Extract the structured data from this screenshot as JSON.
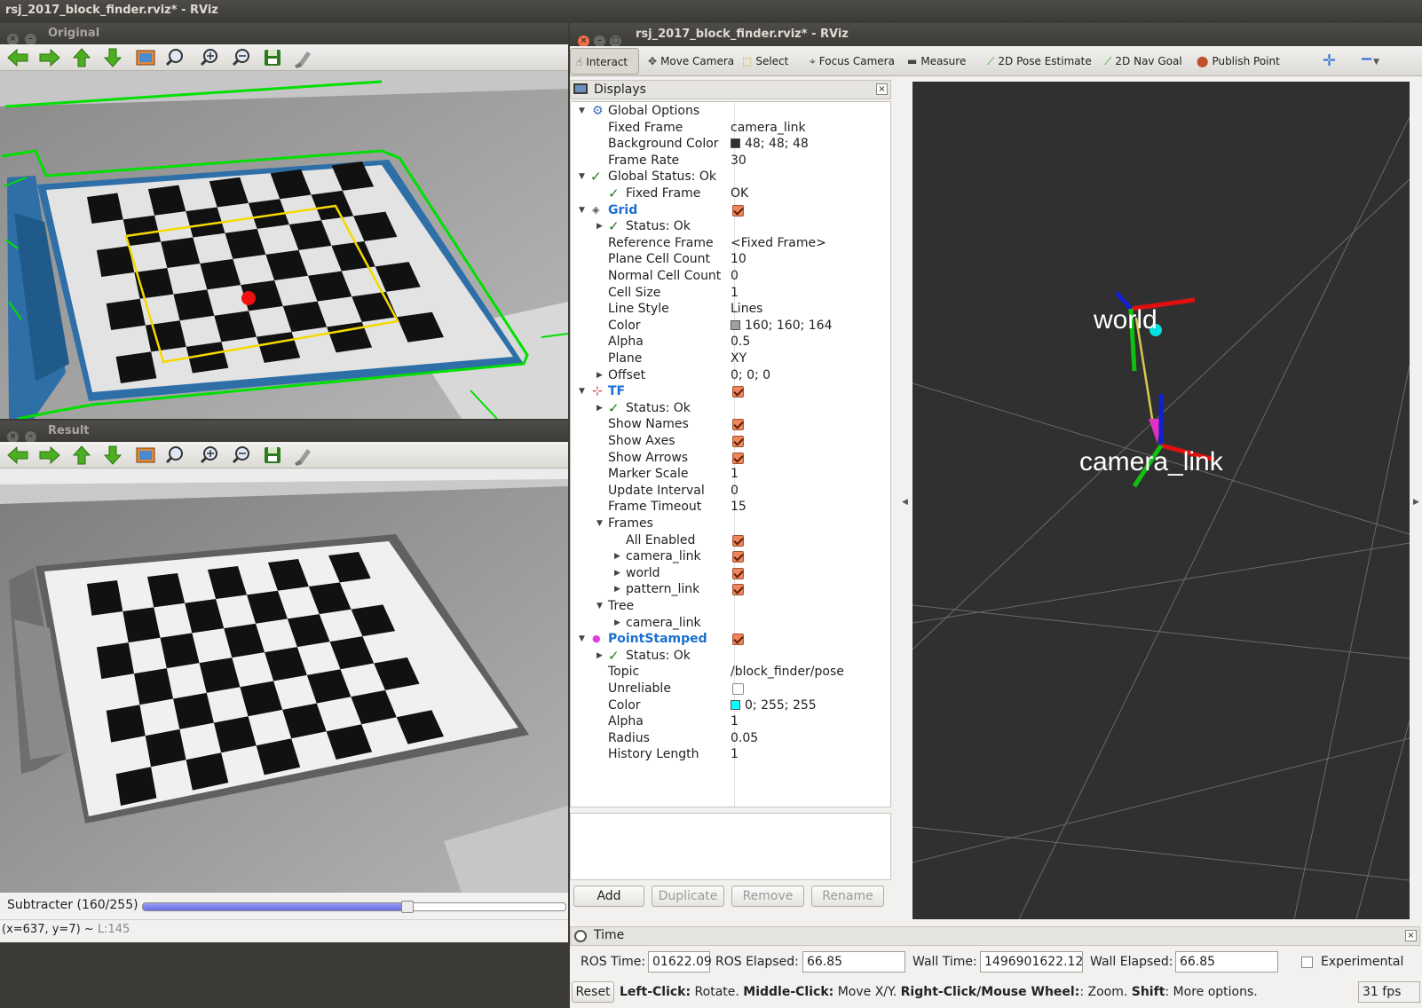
{
  "desktop_title": "rsj_2017_block_finder.rviz* - RViz",
  "original_window": {
    "title": "Original",
    "toolbar_icons": [
      "arrow-left-icon",
      "arrow-right-icon",
      "arrow-up-icon",
      "arrow-down-icon",
      "image-icon",
      "zoom-fit-icon",
      "zoom-in-icon",
      "zoom-out-icon",
      "save-icon",
      "brush-icon"
    ]
  },
  "result_window": {
    "title": "Result",
    "slider_label": "Subtracter (160/255)",
    "slider_value": 0.627,
    "status_coords": "(x=637, y=7) ~",
    "status_level": "L:145"
  },
  "rviz": {
    "title": "rsj_2017_block_finder.rviz* - RViz",
    "tools": [
      {
        "label": "Interact",
        "icon": "cursor-icon"
      },
      {
        "label": "Move Camera",
        "icon": "move-camera-icon"
      },
      {
        "label": "Select",
        "icon": "select-icon"
      },
      {
        "label": "Focus Camera",
        "icon": "focus-camera-icon"
      },
      {
        "label": "Measure",
        "icon": "measure-icon"
      },
      {
        "label": "2D Pose Estimate",
        "icon": "pose-estimate-icon"
      },
      {
        "label": "2D Nav Goal",
        "icon": "nav-goal-icon"
      },
      {
        "label": "Publish Point",
        "icon": "publish-point-icon"
      }
    ],
    "displays_title": "Displays",
    "tree": [
      {
        "label": "Global Options",
        "value": ""
      },
      {
        "label": "Fixed Frame",
        "value": "camera_link"
      },
      {
        "label": "Background Color",
        "value": "48; 48; 48",
        "swatch": "#303030"
      },
      {
        "label": "Frame Rate",
        "value": "30"
      },
      {
        "label": "Global Status: Ok",
        "value": ""
      },
      {
        "label": "Fixed Frame",
        "value": "OK"
      },
      {
        "label": "Grid",
        "value": ""
      },
      {
        "label": "Status: Ok",
        "value": ""
      },
      {
        "label": "Reference Frame",
        "value": "<Fixed Frame>"
      },
      {
        "label": "Plane Cell Count",
        "value": "10"
      },
      {
        "label": "Normal Cell Count",
        "value": "0"
      },
      {
        "label": "Cell Size",
        "value": "1"
      },
      {
        "label": "Line Style",
        "value": "Lines"
      },
      {
        "label": "Color",
        "value": "160; 160; 164",
        "swatch": "#a0a0a4"
      },
      {
        "label": "Alpha",
        "value": "0.5"
      },
      {
        "label": "Plane",
        "value": "XY"
      },
      {
        "label": "Offset",
        "value": "0; 0; 0"
      },
      {
        "label": "TF",
        "value": ""
      },
      {
        "label": "Status: Ok",
        "value": ""
      },
      {
        "label": "Show Names",
        "value": ""
      },
      {
        "label": "Show Axes",
        "value": ""
      },
      {
        "label": "Show Arrows",
        "value": ""
      },
      {
        "label": "Marker Scale",
        "value": "1"
      },
      {
        "label": "Update Interval",
        "value": "0"
      },
      {
        "label": "Frame Timeout",
        "value": "15"
      },
      {
        "label": "Frames",
        "value": ""
      },
      {
        "label": "All Enabled",
        "value": ""
      },
      {
        "label": "camera_link",
        "value": ""
      },
      {
        "label": "world",
        "value": ""
      },
      {
        "label": "pattern_link",
        "value": ""
      },
      {
        "label": "Tree",
        "value": ""
      },
      {
        "label": "camera_link",
        "value": ""
      },
      {
        "label": "PointStamped",
        "value": ""
      },
      {
        "label": "Status: Ok",
        "value": ""
      },
      {
        "label": "Topic",
        "value": "/block_finder/pose"
      },
      {
        "label": "Unreliable",
        "value": ""
      },
      {
        "label": "Color",
        "value": "0; 255; 255",
        "swatch": "#00ffff"
      },
      {
        "label": "Alpha",
        "value": "1"
      },
      {
        "label": "Radius",
        "value": "0.05"
      },
      {
        "label": "History Length",
        "value": "1"
      }
    ],
    "buttons": {
      "add": "Add",
      "duplicate": "Duplicate",
      "remove": "Remove",
      "rename": "Rename"
    },
    "scene_labels": {
      "world": "world",
      "camera": "camera_link"
    },
    "time_panel": {
      "title": "Time",
      "ros_time_label": "ROS Time:",
      "ros_time": "01622.09",
      "ros_elapsed_label": "ROS Elapsed:",
      "ros_elapsed": "66.85",
      "wall_time_label": "Wall Time:",
      "wall_time": "1496901622.12",
      "wall_elapsed_label": "Wall Elapsed:",
      "wall_elapsed": "66.85",
      "experimental": "Experimental"
    },
    "status_bar": {
      "reset": "Reset",
      "h1": "Left-Click:",
      "t1": " Rotate. ",
      "h2": "Middle-Click:",
      "t2": " Move X/Y. ",
      "h3": "Right-Click/Mouse Wheel:",
      "t3": ": Zoom. ",
      "h4": "Shift",
      "t4": ": More options.",
      "fps": "31 fps"
    }
  },
  "colors": {
    "accent_green": "#00e000",
    "checkbox_orange": "#f0845a",
    "tf_blue": "#1a6fd0",
    "pink_dot": "#e040e0"
  }
}
